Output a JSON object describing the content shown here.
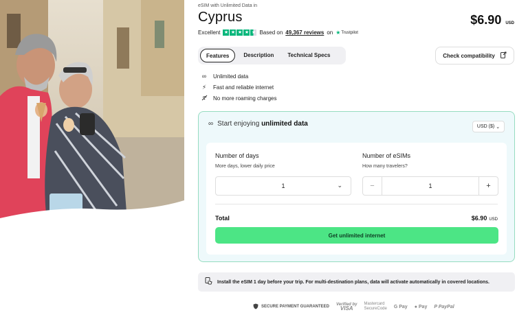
{
  "product": {
    "eyebrow": "eSIM with Unlimited Data in",
    "title": "Cyprus",
    "price": "$6.90",
    "price_currency": "USD"
  },
  "rating": {
    "label": "Excellent",
    "based_on": "Based on",
    "reviews": "49,367 reviews",
    "on": "on",
    "provider": "Trustpilot",
    "score_stars": 4.5,
    "max_stars": 5
  },
  "tabs": [
    {
      "label": "Features",
      "active": true
    },
    {
      "label": "Description",
      "active": false
    },
    {
      "label": "Technical Specs",
      "active": false
    }
  ],
  "check_button": {
    "label": "Check compatibility",
    "icon": "external-check-icon"
  },
  "features": [
    {
      "icon": "infinity-icon",
      "label": "Unlimited data"
    },
    {
      "icon": "lightning-icon",
      "label": "Fast and reliable internet"
    },
    {
      "icon": "no-roaming-icon",
      "label": "No more roaming charges"
    }
  ],
  "panel": {
    "heading_prefix": "Start enjoying",
    "heading_bold": "unlimited data",
    "currency_select": "USD ($)",
    "days": {
      "label": "Number of days",
      "sub": "More days, lower daily price",
      "value": "1"
    },
    "esims": {
      "label": "Number of eSIMs",
      "sub": "How many travelers?",
      "value": "1",
      "minus": "−",
      "plus": "+"
    },
    "total_label": "Total",
    "total_value": "$6.90",
    "total_currency": "USD",
    "cta": "Get unlimited internet"
  },
  "notice": "Install the eSIM 1 day before your trip. For multi-destination plans, data will activate automatically in covered locations.",
  "payments": {
    "secure": "SECURE PAYMENT GUARANTEED",
    "visa_top": "Verified by",
    "visa_bottom": "VISA",
    "mc_top": "Mastercard",
    "mc_bottom": "SecureCode",
    "gpay": "G Pay",
    "applepay": " Pay",
    "paypal": "PayPal"
  },
  "colors": {
    "accent_green": "#4ce585",
    "trustpilot_green": "#00b67a",
    "panel_bg": "#eef9fb",
    "panel_border": "#95dcc0"
  }
}
